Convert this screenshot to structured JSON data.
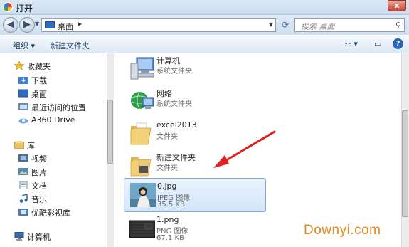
{
  "window": {
    "title": "打开",
    "close_label": "x"
  },
  "address_bar": {
    "location": "桌面",
    "search_placeholder": "搜索 桌面"
  },
  "toolbar": {
    "organize_label": "组织 ▾",
    "new_folder_label": "新建文件夹",
    "help_label": "?"
  },
  "sidebar": {
    "favorites": {
      "label": "收藏夹",
      "items": [
        {
          "label": "下载"
        },
        {
          "label": "桌面"
        },
        {
          "label": "最近访问的位置"
        },
        {
          "label": "A360 Drive"
        }
      ]
    },
    "libraries": {
      "label": "库",
      "items": [
        {
          "label": "视频"
        },
        {
          "label": "图片"
        },
        {
          "label": "文档"
        },
        {
          "label": "音乐"
        },
        {
          "label": "优酷影视库"
        }
      ]
    },
    "computer": {
      "label": "计算机"
    }
  },
  "files": [
    {
      "name": "计算机",
      "type": "系统文件夹",
      "size": "",
      "icon": "computer-icon"
    },
    {
      "name": "网络",
      "type": "系统文件夹",
      "size": "",
      "icon": "network-globe-icon"
    },
    {
      "name": "excel2013",
      "type": "文件夹",
      "size": "",
      "icon": "folder-icon"
    },
    {
      "name": "新建文件夹",
      "type": "文件夹",
      "size": "",
      "icon": "folder-icon"
    },
    {
      "name": "0.jpg",
      "type": "JPEG 图像",
      "size": "35.5 KB",
      "icon": "jpg-thumbnail",
      "selected": true
    },
    {
      "name": "1.png",
      "type": "PNG 图像",
      "size": "67.1 KB",
      "icon": "png-thumbnail"
    }
  ],
  "watermark": "Downyi.com",
  "colors": {
    "accent": "#2f6cc0",
    "selection": "#d3e5fa",
    "watermark": "#e08a1c",
    "arrow": "#e02020"
  }
}
